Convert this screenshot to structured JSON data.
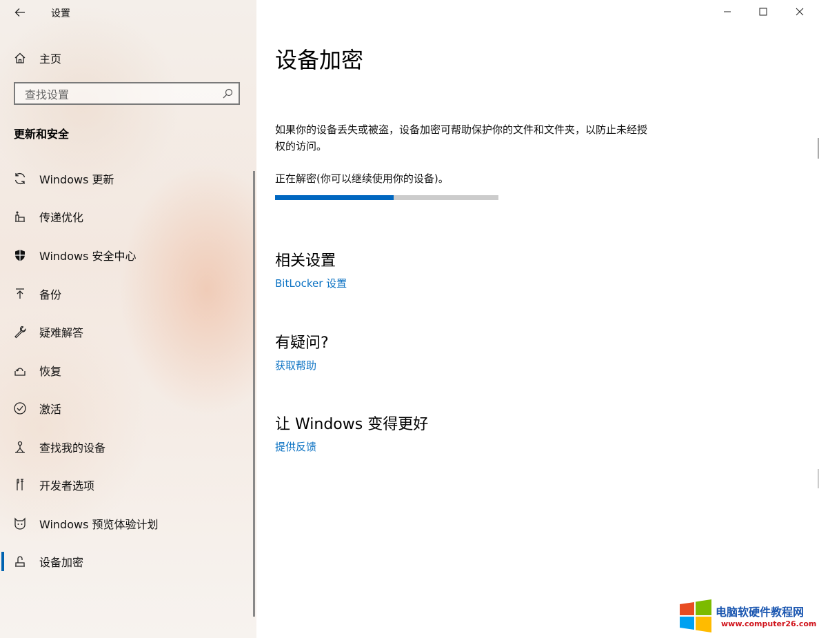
{
  "window": {
    "app_title": "设置",
    "controls": [
      "minimize",
      "maximize",
      "close"
    ]
  },
  "sidebar": {
    "home_label": "主页",
    "search_placeholder": "查找设置",
    "section_title": "更新和安全",
    "items": [
      {
        "label": "Windows 更新",
        "icon": "sync-icon"
      },
      {
        "label": "传递优化",
        "icon": "delivery-optimization-icon"
      },
      {
        "label": "Windows 安全中心",
        "icon": "shield-icon"
      },
      {
        "label": "备份",
        "icon": "backup-upload-icon"
      },
      {
        "label": "疑难解答",
        "icon": "wrench-icon"
      },
      {
        "label": "恢复",
        "icon": "recovery-icon"
      },
      {
        "label": "激活",
        "icon": "check-circle-icon"
      },
      {
        "label": "查找我的设备",
        "icon": "find-device-person-icon"
      },
      {
        "label": "开发者选项",
        "icon": "developer-tools-icon"
      },
      {
        "label": "Windows 预览体验计划",
        "icon": "insider-cat-icon"
      },
      {
        "label": "设备加密",
        "icon": "device-encryption-icon",
        "selected": true
      }
    ]
  },
  "main": {
    "title": "设备加密",
    "description": "如果你的设备丢失或被盗，设备加密可帮助保护你的文件和文件夹，以防止未经授权的访问。",
    "status": "正在解密(你可以继续使用你的设备)。",
    "progress_fraction": 0.53,
    "related_heading": "相关设置",
    "related_link": "BitLocker 设置",
    "help_heading": "有疑问?",
    "help_link": "获取帮助",
    "improve_heading": "让 Windows 变得更好",
    "improve_link": "提供反馈"
  },
  "watermark": {
    "title": "电脑软硬件教程网",
    "url": "www.computer26.com"
  },
  "colors": {
    "accent": "#0067c0",
    "link": "#0b72c3",
    "progress_track": "#cccccc"
  }
}
